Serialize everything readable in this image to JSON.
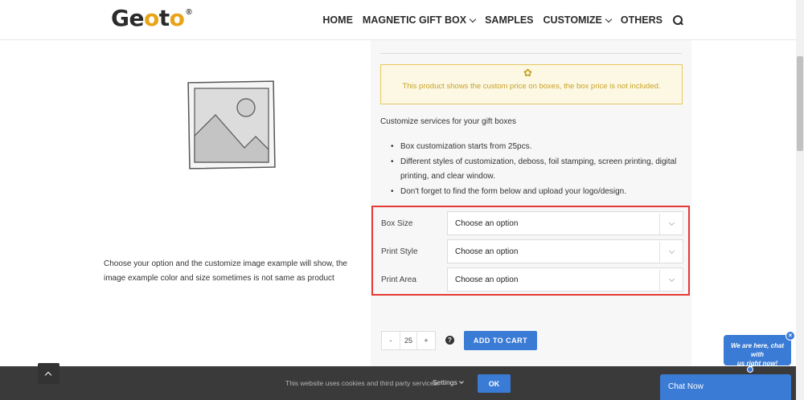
{
  "header": {
    "logo_text_a": "Ge",
    "logo_text_b": "o",
    "logo_text_c": "t",
    "logo_text_d": "o",
    "logo_reg": "®",
    "nav": {
      "home": "HOME",
      "magnetic": "MAGNETIC GIFT BOX",
      "samples": "SAMPLES",
      "customize": "CUSTOMIZE",
      "others": "OTHERS"
    }
  },
  "left": {
    "caption": "Choose your option and the customize image example will show, the image example color and size sometimes is not same as product"
  },
  "notice": {
    "text": "This product shows the custom price on boxes, the box price is not included."
  },
  "customize": {
    "heading": "Customize services for your gift boxes",
    "bullets": [
      "Box customization starts from 25pcs.",
      "Different styles of customization, deboss, foil stamping, screen printing, digital printing, and clear window.",
      "Don't forget to find the form below and upload your logo/design."
    ]
  },
  "options": {
    "box_size_label": "Box Size",
    "box_size_value": "Choose an option",
    "print_style_label": "Print Style",
    "print_style_value": "Choose an option",
    "print_area_label": "Print Area",
    "print_area_value": "Choose an option"
  },
  "cart": {
    "minus": "-",
    "quantity": "25",
    "plus": "+",
    "help": "?",
    "add_label": "ADD TO CART"
  },
  "cookie": {
    "text": "This website uses cookies and third party services.",
    "settings": "Settings",
    "ok": "OK"
  },
  "chat": {
    "bubble_line1": "We are here, chat with",
    "bubble_line2": "us right now!",
    "close": "×",
    "bar_label": "Chat Now"
  },
  "colors": {
    "accent": "#3a7bd5",
    "notice_text": "#c9a227",
    "notice_bg": "#fcf8e3",
    "highlight_border": "#e53935",
    "logo_accent": "#e8a317"
  }
}
